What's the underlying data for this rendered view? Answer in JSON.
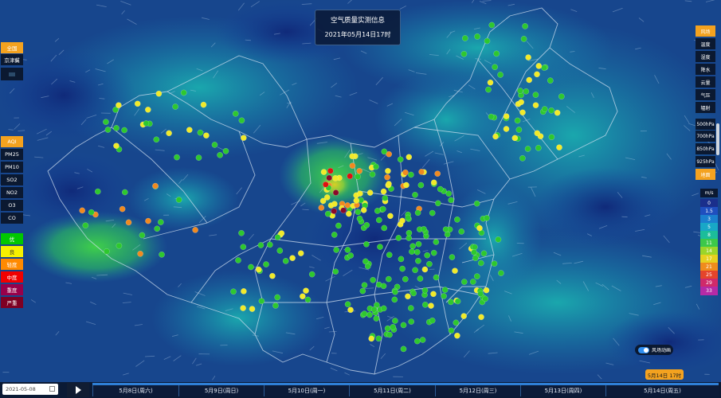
{
  "title": {
    "line1": "空气质量实测信息",
    "line2": "2021年05月14日17时"
  },
  "left_region": {
    "items": [
      {
        "label": "全国",
        "active": true
      },
      {
        "label": "京津冀",
        "active": false
      }
    ]
  },
  "left_pollutants": {
    "items": [
      {
        "label": "AQI",
        "active": true
      },
      {
        "label": "PM25",
        "active": false
      },
      {
        "label": "PM10",
        "active": false
      },
      {
        "label": "SO2",
        "active": false
      },
      {
        "label": "NO2",
        "active": false
      },
      {
        "label": "O3",
        "active": false
      },
      {
        "label": "CO",
        "active": false
      }
    ]
  },
  "left_legend": {
    "items": [
      {
        "label": "优",
        "color": "#00c800"
      },
      {
        "label": "良",
        "color": "#f6f000"
      },
      {
        "label": "轻度",
        "color": "#ff8a00"
      },
      {
        "label": "中度",
        "color": "#f00000"
      },
      {
        "label": "重度",
        "color": "#98004a"
      },
      {
        "label": "严重",
        "color": "#7e0023"
      }
    ]
  },
  "right_layers": {
    "items": [
      {
        "label": "风场",
        "active": true
      },
      {
        "label": "温度",
        "active": false
      },
      {
        "label": "湿度",
        "active": false
      },
      {
        "label": "降水",
        "active": false
      },
      {
        "label": "云量",
        "active": false
      },
      {
        "label": "气压",
        "active": false
      },
      {
        "label": "辐射",
        "active": false
      }
    ]
  },
  "right_levels": {
    "items": [
      {
        "label": "500hPa",
        "active": false
      },
      {
        "label": "700hPa",
        "active": false
      },
      {
        "label": "850hPa",
        "active": false
      },
      {
        "label": "925hPa",
        "active": false
      },
      {
        "label": "地面",
        "active": true
      }
    ]
  },
  "wind_legend": {
    "unit": "m/s",
    "items": [
      {
        "label": "0",
        "color": "#1a2f8c"
      },
      {
        "label": "1.5",
        "color": "#1f4fbf"
      },
      {
        "label": "3",
        "color": "#1b7fcf"
      },
      {
        "label": "5",
        "color": "#18a7c7"
      },
      {
        "label": "8",
        "color": "#1cbd9a"
      },
      {
        "label": "11",
        "color": "#3cc84a"
      },
      {
        "label": "14",
        "color": "#9bd52a"
      },
      {
        "label": "17",
        "color": "#e7d01f"
      },
      {
        "label": "21",
        "color": "#f08c1c"
      },
      {
        "label": "25",
        "color": "#e5442b"
      },
      {
        "label": "29",
        "color": "#cf2a6a"
      },
      {
        "label": "33",
        "color": "#b42aa6"
      }
    ]
  },
  "wind_toggle": {
    "label": "风场动画",
    "on": true
  },
  "current_time_badge": "5月14日 17时",
  "date_input": {
    "value": "2021-05-08"
  },
  "timeline": {
    "days": [
      "5月8日(周六)",
      "5月9日(周日)",
      "5月10日(周一)",
      "5月11日(周二)",
      "5月12日(周三)",
      "5月13日(周四)",
      "5月14日(周五)"
    ]
  },
  "map": {
    "colors": {
      "ocean": "#17428a",
      "land": "#1f5ea5",
      "boundary": "#c9d8ea"
    }
  }
}
